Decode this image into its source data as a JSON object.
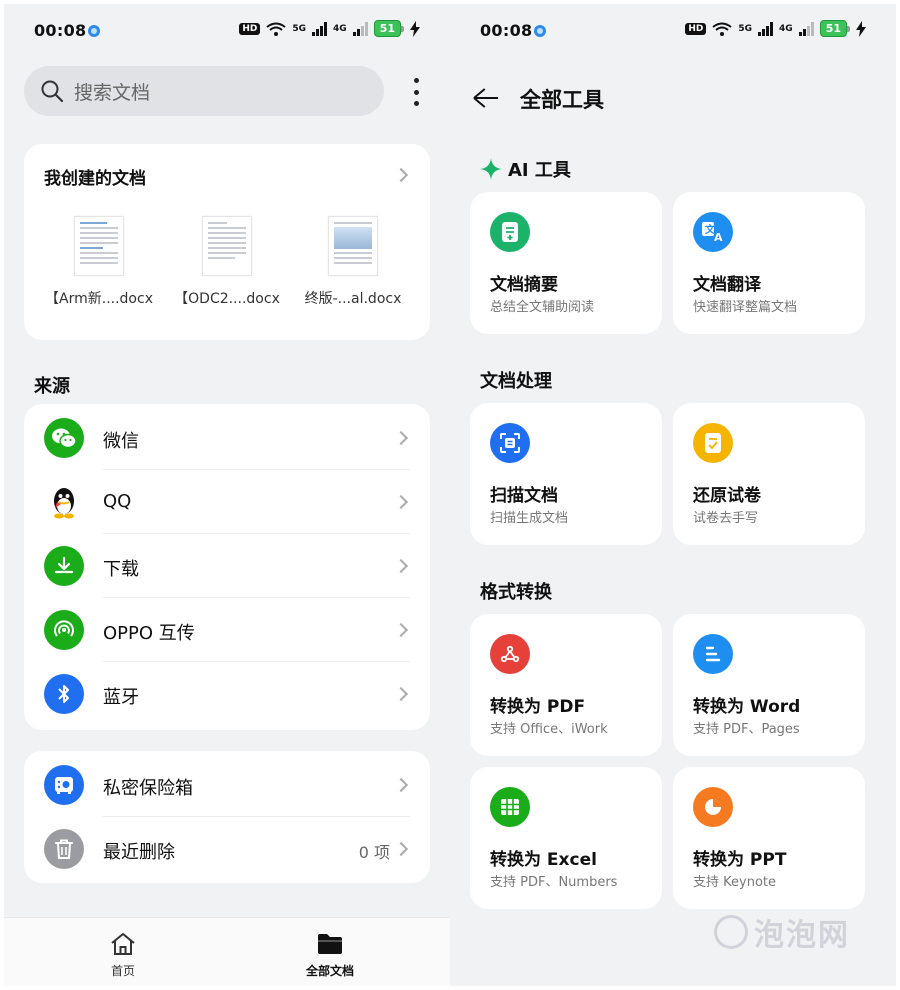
{
  "status": {
    "time": "00:08",
    "hd": "HD",
    "net5g": "5G",
    "net4g": "4G",
    "battery": "51"
  },
  "left": {
    "search_placeholder": "搜索文档",
    "docs": {
      "title": "我创建的文档",
      "items": [
        {
          "name": "【Arm新....docx"
        },
        {
          "name": "【ODC2....docx"
        },
        {
          "name": "终版-...al.docx"
        }
      ]
    },
    "sources_title": "来源",
    "sources": [
      {
        "label": "微信",
        "icon": "wechat-icon",
        "color": "#1aad19"
      },
      {
        "label": "QQ",
        "icon": "qq-icon",
        "color": "#ffffff"
      },
      {
        "label": "下载",
        "icon": "download-icon",
        "color": "#1aad19"
      },
      {
        "label": "OPPO 互传",
        "icon": "share-icon",
        "color": "#1aad19"
      },
      {
        "label": "蓝牙",
        "icon": "bluetooth-icon",
        "color": "#1f6ff0"
      }
    ],
    "private": [
      {
        "label": "私密保险箱",
        "icon": "safe-icon",
        "color": "#1f6ff0",
        "count": ""
      },
      {
        "label": "最近删除",
        "icon": "trash-icon",
        "color": "#9a9ca2",
        "count": "0 项"
      }
    ],
    "tabs": [
      {
        "label": "首页",
        "icon": "home-icon"
      },
      {
        "label": "全部文档",
        "icon": "folder-icon"
      }
    ]
  },
  "right": {
    "title": "全部工具",
    "sections": [
      {
        "title": "AI 工具",
        "tools": [
          {
            "name": "文档摘要",
            "desc": "总结全文辅助阅读",
            "icon": "summary-icon",
            "color": "#1bb36a"
          },
          {
            "name": "文档翻译",
            "desc": "快速翻译整篇文档",
            "icon": "translate-icon",
            "color": "#1e8ff0"
          }
        ]
      },
      {
        "title": "文档处理",
        "tools": [
          {
            "name": "扫描文档",
            "desc": "扫描生成文档",
            "icon": "scan-icon",
            "color": "#1f6ff0"
          },
          {
            "name": "还原试卷",
            "desc": "试卷去手写",
            "icon": "exam-icon",
            "color": "#f5b400"
          }
        ]
      },
      {
        "title": "格式转换",
        "tools": [
          {
            "name": "转换为 PDF",
            "desc": "支持 Office、iWork",
            "icon": "pdf-icon",
            "color": "#e5413a"
          },
          {
            "name": "转换为 Word",
            "desc": "支持 PDF、Pages",
            "icon": "word-icon",
            "color": "#1e8ff0"
          },
          {
            "name": "转换为 Excel",
            "desc": "支持 PDF、Numbers",
            "icon": "excel-icon",
            "color": "#1aad19"
          },
          {
            "name": "转换为 PPT",
            "desc": "支持 Keynote",
            "icon": "ppt-icon",
            "color": "#f57a20"
          }
        ]
      }
    ],
    "watermark": "泡泡网"
  }
}
